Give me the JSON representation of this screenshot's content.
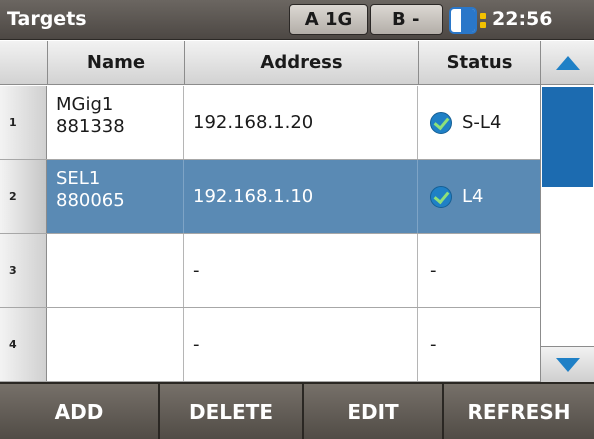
{
  "header": {
    "title": "Targets",
    "port_a": "A 1G",
    "port_b": "B -",
    "battery_icon": "battery-icon",
    "power_icon": "power-plug-icon",
    "time": "22:56"
  },
  "table": {
    "columns": [
      "Name",
      "Address",
      "Status"
    ],
    "rows": [
      {
        "num": "1",
        "name_line1": "MGig1",
        "name_line2": "881338",
        "address": "192.168.1.20",
        "status": "S-L4",
        "status_icon": "check-icon",
        "selected": false
      },
      {
        "num": "2",
        "name_line1": "SEL1",
        "name_line2": "880065",
        "address": "192.168.1.10",
        "status": "L4",
        "status_icon": "check-icon",
        "selected": true
      },
      {
        "num": "3",
        "name_line1": "",
        "name_line2": "",
        "address": "-",
        "status": "-",
        "selected": false
      },
      {
        "num": "4",
        "name_line1": "",
        "name_line2": "",
        "address": "-",
        "status": "-",
        "selected": false
      }
    ]
  },
  "scrollbar": {
    "up_icon": "scroll-up-arrow-icon",
    "down_icon": "scroll-down-arrow-icon"
  },
  "softkeys": [
    "ADD",
    "DELETE",
    "EDIT",
    "REFRESH"
  ],
  "colors": {
    "header_bg": "#5c5752",
    "selected_row": "#5a8ab4",
    "accent_blue": "#1f80c6",
    "scroll_thumb": "#1c6bb0",
    "check_green": "#8ee07a",
    "plug_yellow": "#f2c100"
  }
}
